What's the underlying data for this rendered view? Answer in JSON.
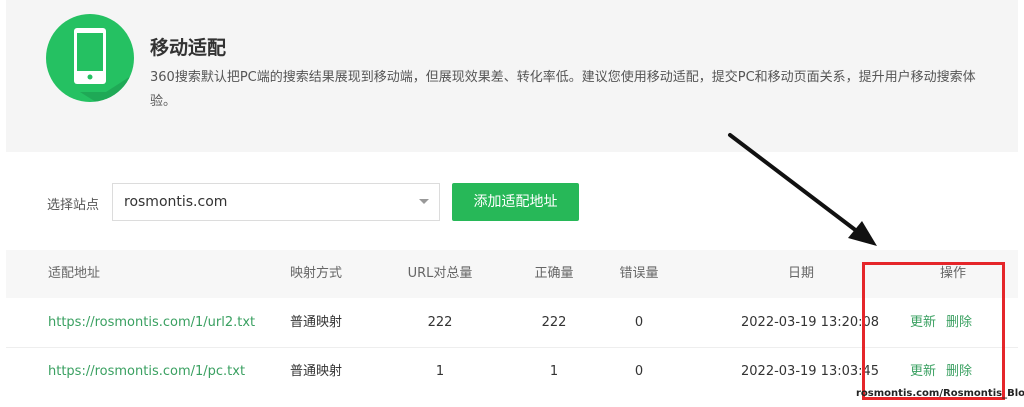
{
  "header": {
    "title": "移动适配",
    "description": "360搜索默认把PC端的搜索结果展现到移动端，但展现效果差、转化率低。建议您使用移动适配，提交PC和移动页面关系，提升用户移动搜索体验。",
    "icon": "mobile-phone-icon",
    "accent_color": "#25c162"
  },
  "controls": {
    "site_label": "选择站点",
    "site_value": "rosmontis.com",
    "add_button": "添加适配地址"
  },
  "table": {
    "headers": {
      "url": "适配地址",
      "type": "映射方式",
      "total": "URL对总量",
      "correct": "正确量",
      "errors": "错误量",
      "date": "日期",
      "ops": "操作"
    },
    "rows": [
      {
        "url": "https://rosmontis.com/1/url2.txt",
        "type": "普通映射",
        "total": "222",
        "correct": "222",
        "errors": "0",
        "date": "2022-03-19 13:20:08",
        "op_update": "更新",
        "op_delete": "删除"
      },
      {
        "url": "https://rosmontis.com/1/pc.txt",
        "type": "普通映射",
        "total": "1",
        "correct": "1",
        "errors": "0",
        "date": "2022-03-19 13:03:45",
        "op_update": "更新",
        "op_delete": "删除"
      }
    ]
  },
  "annotation": {
    "highlight_color": "#e5262a"
  },
  "watermark": "rosmontis.com/Rosmontis_Blog"
}
